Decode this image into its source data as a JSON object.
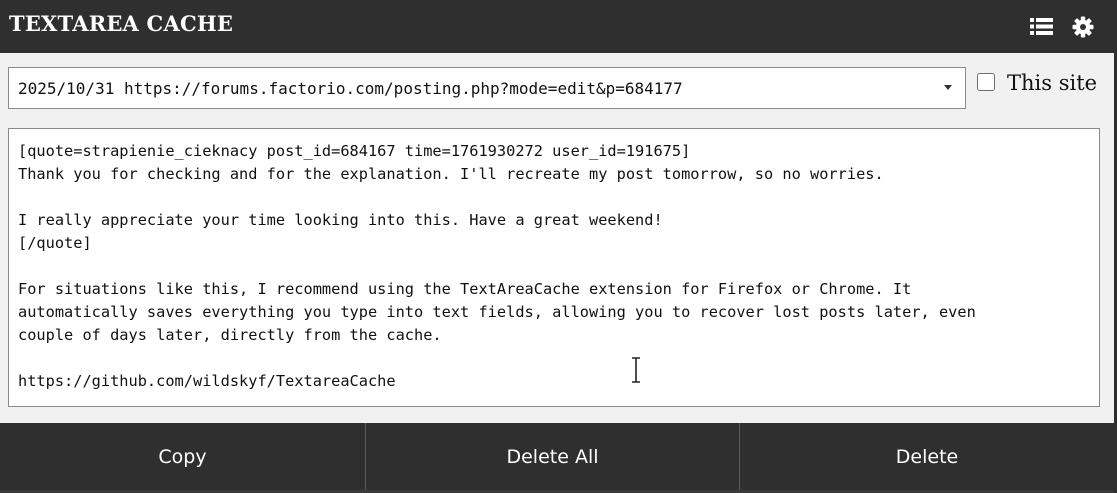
{
  "header": {
    "title": "TEXTAREA CACHE",
    "list_icon": "list-icon",
    "settings_icon": "gear-icon"
  },
  "selector": {
    "selected": "2025/10/31 https://forums.factorio.com/posting.php?mode=edit&p=684177"
  },
  "this_site": {
    "label": "This site",
    "checked": false
  },
  "textarea": {
    "content": "[quote=strapienie_cieknacy post_id=684167 time=1761930272 user_id=191675]\nThank you for checking and for the explanation. I'll recreate my post tomorrow, so no worries.\n\nI really appreciate your time looking into this. Have a great weekend!\n[/quote]\n\nFor situations like this, I recommend using the TextAreaCache extension for Firefox or Chrome. It\nautomatically saves everything you type into text fields, allowing you to recover lost posts later, even\ncouple of days later, directly from the cache.\n\nhttps://github.com/wildskyf/TextareaCache"
  },
  "footer": {
    "copy_label": "Copy",
    "delete_all_label": "Delete All",
    "delete_label": "Delete"
  },
  "colors": {
    "bar": "#2f2f2f",
    "panel": "#f1f1f1",
    "text_light": "#ffffff"
  }
}
